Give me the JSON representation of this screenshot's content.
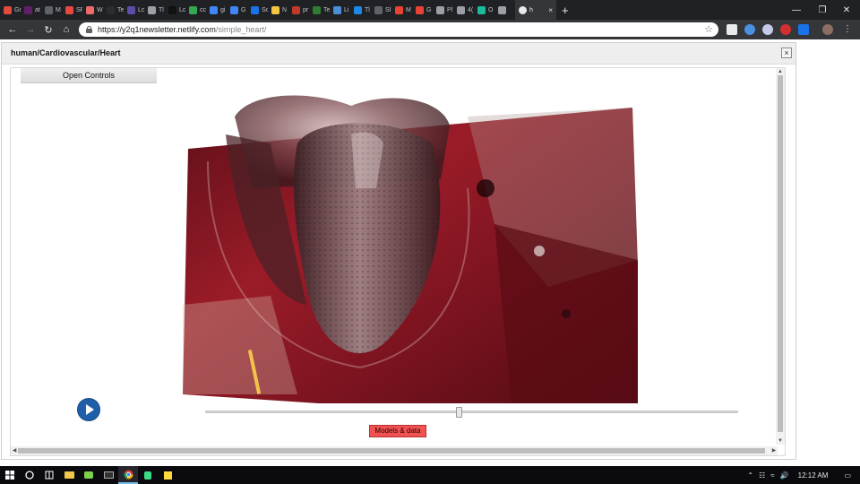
{
  "browser": {
    "tabs": [
      {
        "label": "Gr",
        "color": "#e24b3b"
      },
      {
        "label": "at",
        "color": "#611f69"
      },
      {
        "label": "M",
        "color": "#5f6368"
      },
      {
        "label": "SF",
        "color": "#e8473f"
      },
      {
        "label": "W",
        "color": "#f06a6a"
      },
      {
        "label": "Te",
        "color": "#2d2d2d"
      },
      {
        "label": "Lc",
        "color": "#5a4ca8"
      },
      {
        "label": "Tl",
        "color": "#9aa0a6"
      },
      {
        "label": "Lc",
        "color": "#111111"
      },
      {
        "label": "cc",
        "color": "#34a853"
      },
      {
        "label": "gi",
        "color": "#4285f4"
      },
      {
        "label": "G",
        "color": "#4285f4"
      },
      {
        "label": "Sc",
        "color": "#1a73e8"
      },
      {
        "label": "N",
        "color": "#f4c542"
      },
      {
        "label": "pr",
        "color": "#c0392b"
      },
      {
        "label": "Te",
        "color": "#2e7d32"
      },
      {
        "label": "Li",
        "color": "#4a90d9"
      },
      {
        "label": "Tl",
        "color": "#1e88e5"
      },
      {
        "label": "Sl",
        "color": "#5f6368"
      },
      {
        "label": "M",
        "color": "#ea4335"
      },
      {
        "label": "G",
        "color": "#ea4335"
      },
      {
        "label": "Pl",
        "color": "#9aa0a6"
      },
      {
        "label": "4(",
        "color": "#9aa0a6"
      },
      {
        "label": "O",
        "color": "#1abc9c"
      },
      {
        "label": "",
        "color": "#9aa0a6"
      }
    ],
    "active_tab": {
      "label": "h",
      "close": "×"
    },
    "new_tab": "+",
    "window_controls": [
      "—",
      "❐",
      "✕"
    ],
    "url_host": "https://y2q1newsletter.netlify.com",
    "url_path": "/simple_heart/",
    "bookmark_star": "☆"
  },
  "page": {
    "title": "human/Cardiovascular/Heart",
    "close_label": "×",
    "open_controls": "Open Controls",
    "models_button": "Models & data",
    "timeline_progress": 0.47
  },
  "taskbar": {
    "clock": "12:12 AM"
  }
}
